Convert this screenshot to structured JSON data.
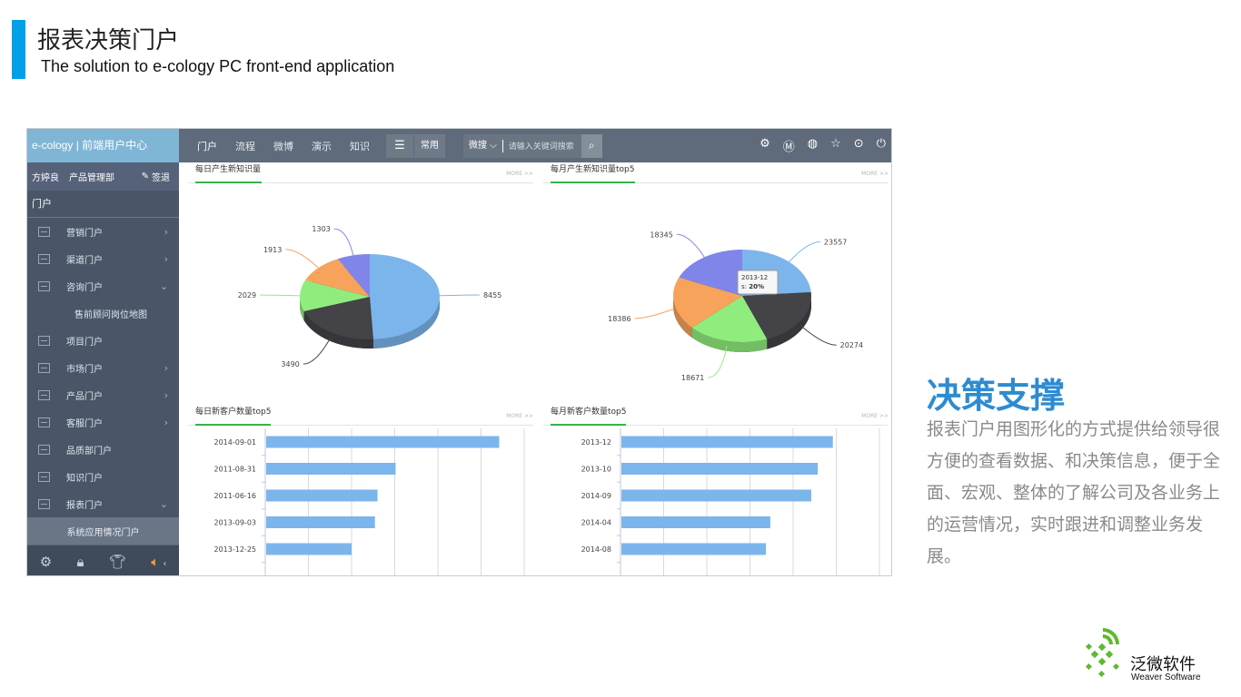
{
  "slide": {
    "title": "报表决策门户",
    "subtitle": "The solution  to e-cology PC front-end application"
  },
  "app": {
    "brand": "e-cology | 前端用户中心",
    "user": {
      "name": "方婷良",
      "dept": "产品管理部",
      "sign_label": "签退"
    },
    "sidebar_heading": "门户",
    "menu": [
      {
        "label": "营销门户",
        "arrow": "›"
      },
      {
        "label": "渠道门户",
        "arrow": "›"
      },
      {
        "label": "咨询门户",
        "arrow": "⌄"
      },
      {
        "label": "售前顾问岗位地图",
        "arrow": ""
      },
      {
        "label": "项目门户",
        "arrow": ""
      },
      {
        "label": "市场门户",
        "arrow": "›"
      },
      {
        "label": "产品门户",
        "arrow": "›"
      },
      {
        "label": "客服门户",
        "arrow": "›"
      },
      {
        "label": "品质部门户",
        "arrow": ""
      },
      {
        "label": "知识门户",
        "arrow": ""
      },
      {
        "label": "报表门户",
        "arrow": "⌄"
      },
      {
        "label": "系统应用情况门户",
        "arrow": ""
      }
    ],
    "footer_icons": [
      "settings-icon",
      "lock-icon",
      "shirt-icon",
      "speaker-icon"
    ],
    "footer_arrow": "‹",
    "nav": [
      "门户",
      "流程",
      "微博",
      "演示",
      "知识"
    ],
    "fav_label": "常用",
    "search": {
      "scope": "微搜",
      "placeholder": "请输入关键词搜索"
    },
    "tool_icons": [
      "gear-group-icon",
      "m-circle-icon",
      "globe-icon",
      "star-icon",
      "more-icon",
      "power-icon"
    ],
    "more_label": "MORE >>"
  },
  "chart_data": [
    {
      "type": "pie",
      "title": "每日产生新知识量",
      "slices": [
        {
          "label": "8455",
          "value": 8455,
          "color": "#7cb5ec"
        },
        {
          "label": "3490",
          "value": 3490,
          "color": "#434348"
        },
        {
          "label": "2029",
          "value": 2029,
          "color": "#90ed7d"
        },
        {
          "label": "1913",
          "value": 1913,
          "color": "#f7a35c"
        },
        {
          "label": "1303",
          "value": 1303,
          "color": "#8085e9"
        }
      ]
    },
    {
      "type": "pie",
      "title": "每月产生新知识量top5",
      "slices": [
        {
          "label": "23557",
          "value": 23557,
          "color": "#7cb5ec"
        },
        {
          "label": "20274",
          "value": 20274,
          "color": "#434348"
        },
        {
          "label": "18671",
          "value": 18671,
          "color": "#90ed7d"
        },
        {
          "label": "18386",
          "value": 18386,
          "color": "#f7a35c"
        },
        {
          "label": "18345",
          "value": 18345,
          "color": "#8085e9"
        }
      ],
      "tooltip": {
        "title": "2013-12",
        "prefix": "s: ",
        "value": "20%"
      }
    },
    {
      "type": "bar",
      "title": "每日新客户数量top5",
      "categories": [
        "2014-09-01",
        "2011-08-31",
        "2011-06-16",
        "2013-09-03",
        "2013-12-25"
      ],
      "values": [
        45,
        25,
        21.5,
        21,
        16.5
      ],
      "xlim": [
        0,
        50
      ],
      "color": "#7cb5ec"
    },
    {
      "type": "bar",
      "title": "每月新客户数量top5",
      "categories": [
        "2013-12",
        "2013-10",
        "2014-09",
        "2014-04",
        "2014-08"
      ],
      "values": [
        49,
        45.5,
        44,
        34.5,
        33.5
      ],
      "xlim": [
        0,
        60
      ],
      "color": "#7cb5ec"
    }
  ],
  "feature": {
    "heading": "决策支撑",
    "body": "报表门户用图形化的方式提供给领导很方便的查看数据、和决策信息，便于全面、宏观、整体的了解公司及各业务上的运营情况，实时跟进和调整业务发展。"
  },
  "logo": {
    "cn": "泛微软件",
    "en": "Weaver Software"
  }
}
